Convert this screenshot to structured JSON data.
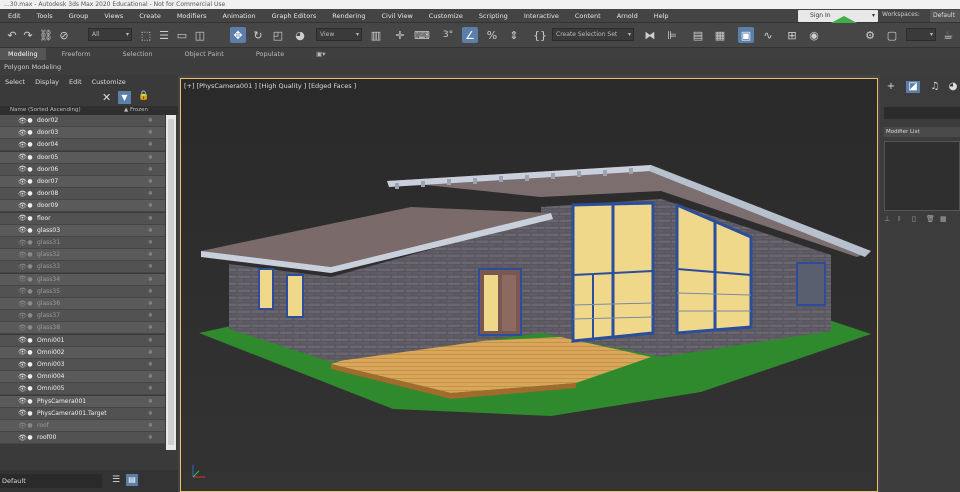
{
  "window": {
    "title": "...30.max - Autodesk 3ds Max 2020 Educational - Not for Commercial Use"
  },
  "menu": [
    "Edit",
    "Tools",
    "Group",
    "Views",
    "Create",
    "Modifiers",
    "Animation",
    "Graph Editors",
    "Rendering",
    "Civil View",
    "Customize",
    "Scripting",
    "Interactive",
    "Content",
    "Arnold",
    "Help"
  ],
  "account": {
    "signin": "Sign In",
    "workspaces_label": "Workspaces:",
    "workspace_value": "Default"
  },
  "toolbar": {
    "filter_value": "All",
    "view_value": "View",
    "selection_set": "Create Selection Set",
    "icons": [
      "undo-icon",
      "redo-icon",
      "link-icon",
      "unlink-icon",
      "bind-space-warp-icon",
      "select-object-icon",
      "select-by-name-icon",
      "rectangle-selection-icon",
      "window-crossing-icon",
      "select-move-icon",
      "select-rotate-icon",
      "select-scale-icon",
      "place-icon",
      "use-pivot-icon",
      "keyboard-shortcut-icon",
      "snaps-toggle-icon",
      "angle-snap-icon",
      "percent-snap-icon",
      "spinner-snap-icon",
      "edit-named-sets-icon",
      "mirror-icon",
      "align-icon",
      "toggle-scene-explorer-icon",
      "toggle-layer-explorer-icon",
      "toolbars-icon",
      "curve-editor-icon",
      "schematic-view-icon",
      "material-editor-icon",
      "render-setup-icon",
      "rendered-frame-icon",
      "render-icon"
    ]
  },
  "ribbon": {
    "tabs": [
      "Modeling",
      "Freeform",
      "Selection",
      "Object Paint",
      "Populate"
    ],
    "sub_label": "Polygon Modeling"
  },
  "explorer": {
    "menu": [
      "Select",
      "Display",
      "Edit",
      "Customize"
    ],
    "col_name": "Name (Sorted Ascending)",
    "col_frozen": "▲ Frozen",
    "layer": "Default",
    "rows": [
      {
        "name": "door02",
        "dim": false
      },
      {
        "name": "door03",
        "dim": false
      },
      {
        "name": "door04",
        "dim": false
      },
      {
        "name": "door05",
        "dim": false
      },
      {
        "name": "door06",
        "dim": false
      },
      {
        "name": "door07",
        "dim": false
      },
      {
        "name": "door08",
        "dim": false
      },
      {
        "name": "door09",
        "dim": false
      },
      {
        "name": "floor",
        "dim": false
      },
      {
        "name": "glass03",
        "dim": false
      },
      {
        "name": "glass31",
        "dim": true
      },
      {
        "name": "glass32",
        "dim": true
      },
      {
        "name": "glass33",
        "dim": true
      },
      {
        "name": "glass34",
        "dim": true
      },
      {
        "name": "glass35",
        "dim": true
      },
      {
        "name": "glass36",
        "dim": true
      },
      {
        "name": "glass37",
        "dim": true
      },
      {
        "name": "glass38",
        "dim": true
      },
      {
        "name": "Omni001",
        "dim": false
      },
      {
        "name": "Omni002",
        "dim": false
      },
      {
        "name": "Omni003",
        "dim": false
      },
      {
        "name": "Omni004",
        "dim": false
      },
      {
        "name": "Omni005",
        "dim": false
      },
      {
        "name": "PhysCamera001",
        "dim": false
      },
      {
        "name": "PhysCamera001.Target",
        "dim": false
      },
      {
        "name": "roof",
        "dim": true
      },
      {
        "name": "roof00",
        "dim": false
      }
    ]
  },
  "viewport": {
    "label": "[+] [PhysCamera001 ] [High Quality ] [Edged Faces ]"
  },
  "command_panel": {
    "modifier_list": "Modifier List"
  },
  "colors": {
    "accent": "#5b7fa8",
    "viewport_border": "#e7c26a",
    "grass": "#2f8a2e",
    "deck": "#d8a85a",
    "brick": "#5a5560",
    "window_glow": "#f0d88a",
    "frame": "#2a4d9c"
  }
}
